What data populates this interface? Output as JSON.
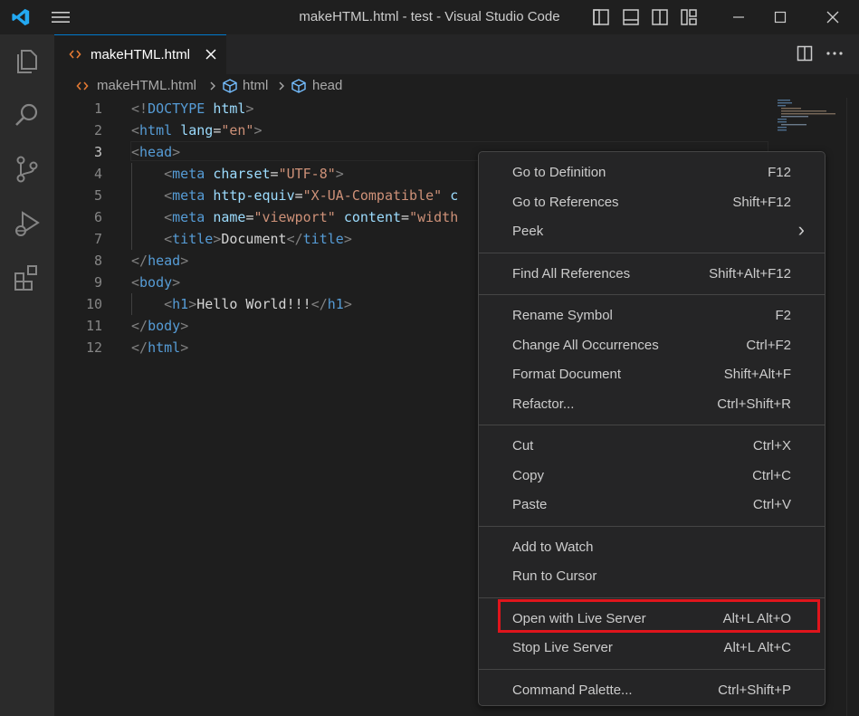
{
  "window": {
    "title": "makeHTML.html - test - Visual Studio Code"
  },
  "tab": {
    "label": "makeHTML.html"
  },
  "breadcrumb": [
    "makeHTML.html",
    "html",
    "head"
  ],
  "editor": {
    "line_numbers": [
      "1",
      "2",
      "3",
      "4",
      "5",
      "6",
      "7",
      "8",
      "9",
      "10",
      "11",
      "12"
    ],
    "lines": [
      [
        [
          "punct",
          "<!"
        ],
        [
          "tag",
          "DOCTYPE"
        ],
        [
          "txt",
          " "
        ],
        [
          "attr",
          "html"
        ],
        [
          "punct",
          ">"
        ]
      ],
      [
        [
          "punct",
          "<"
        ],
        [
          "tag",
          "html"
        ],
        [
          "txt",
          " "
        ],
        [
          "attr",
          "lang"
        ],
        [
          "txt",
          "="
        ],
        [
          "str",
          "\"en\""
        ],
        [
          "punct",
          ">"
        ]
      ],
      [
        [
          "punct",
          "<"
        ],
        [
          "tag",
          "head"
        ],
        [
          "punct",
          ">"
        ]
      ],
      [
        [
          "txt",
          "    "
        ],
        [
          "punct",
          "<"
        ],
        [
          "tag",
          "meta"
        ],
        [
          "txt",
          " "
        ],
        [
          "attr",
          "charset"
        ],
        [
          "txt",
          "="
        ],
        [
          "str",
          "\"UTF-8\""
        ],
        [
          "punct",
          ">"
        ]
      ],
      [
        [
          "txt",
          "    "
        ],
        [
          "punct",
          "<"
        ],
        [
          "tag",
          "meta"
        ],
        [
          "txt",
          " "
        ],
        [
          "attr",
          "http-equiv"
        ],
        [
          "txt",
          "="
        ],
        [
          "str",
          "\"X-UA-Compatible\""
        ],
        [
          "txt",
          " "
        ],
        [
          "attr",
          "c"
        ]
      ],
      [
        [
          "txt",
          "    "
        ],
        [
          "punct",
          "<"
        ],
        [
          "tag",
          "meta"
        ],
        [
          "txt",
          " "
        ],
        [
          "attr",
          "name"
        ],
        [
          "txt",
          "="
        ],
        [
          "str",
          "\"viewport\""
        ],
        [
          "txt",
          " "
        ],
        [
          "attr",
          "content"
        ],
        [
          "txt",
          "="
        ],
        [
          "str",
          "\"width"
        ]
      ],
      [
        [
          "txt",
          "    "
        ],
        [
          "punct",
          "<"
        ],
        [
          "tag",
          "title"
        ],
        [
          "punct",
          ">"
        ],
        [
          "txt",
          "Document"
        ],
        [
          "punct",
          "</"
        ],
        [
          "tag",
          "title"
        ],
        [
          "punct",
          ">"
        ]
      ],
      [
        [
          "punct",
          "</"
        ],
        [
          "tag",
          "head"
        ],
        [
          "punct",
          ">"
        ]
      ],
      [
        [
          "punct",
          "<"
        ],
        [
          "tag",
          "body"
        ],
        [
          "punct",
          ">"
        ]
      ],
      [
        [
          "txt",
          "    "
        ],
        [
          "punct",
          "<"
        ],
        [
          "tag",
          "h1"
        ],
        [
          "punct",
          ">"
        ],
        [
          "txt",
          "Hello World!!!"
        ],
        [
          "punct",
          "</"
        ],
        [
          "tag",
          "h1"
        ],
        [
          "punct",
          ">"
        ]
      ],
      [
        [
          "punct",
          "</"
        ],
        [
          "tag",
          "body"
        ],
        [
          "punct",
          ">"
        ]
      ],
      [
        [
          "punct",
          "</"
        ],
        [
          "tag",
          "html"
        ],
        [
          "punct",
          ">"
        ]
      ]
    ]
  },
  "context_menu": {
    "groups": [
      [
        {
          "label": "Go to Definition",
          "shortcut": "F12"
        },
        {
          "label": "Go to References",
          "shortcut": "Shift+F12"
        },
        {
          "label": "Peek",
          "shortcut": "›"
        }
      ],
      [
        {
          "label": "Find All References",
          "shortcut": "Shift+Alt+F12"
        }
      ],
      [
        {
          "label": "Rename Symbol",
          "shortcut": "F2"
        },
        {
          "label": "Change All Occurrences",
          "shortcut": "Ctrl+F2"
        },
        {
          "label": "Format Document",
          "shortcut": "Shift+Alt+F"
        },
        {
          "label": "Refactor...",
          "shortcut": "Ctrl+Shift+R"
        }
      ],
      [
        {
          "label": "Cut",
          "shortcut": "Ctrl+X"
        },
        {
          "label": "Copy",
          "shortcut": "Ctrl+C"
        },
        {
          "label": "Paste",
          "shortcut": "Ctrl+V"
        }
      ],
      [
        {
          "label": "Add to Watch",
          "shortcut": ""
        },
        {
          "label": "Run to Cursor",
          "shortcut": ""
        }
      ],
      [
        {
          "label": "Open with Live Server",
          "shortcut": "Alt+L Alt+O"
        },
        {
          "label": "Stop Live Server",
          "shortcut": "Alt+L Alt+C"
        }
      ],
      [
        {
          "label": "Command Palette...",
          "shortcut": "Ctrl+Shift+P"
        }
      ]
    ]
  },
  "colors": {
    "accent": "#007acc",
    "highlight_box": "#e0151c",
    "vscode_logo": "#23a9f2",
    "html_file_icon": "#e37933"
  },
  "icons": [
    "vscode-logo-icon",
    "menu-icon",
    "explorer-icon",
    "search-icon",
    "source-control-icon",
    "run-debug-icon",
    "extensions-icon",
    "html-file-icon",
    "close-icon",
    "split-editor-icon",
    "more-actions-icon",
    "symbol-icon",
    "chevron-right-icon"
  ]
}
